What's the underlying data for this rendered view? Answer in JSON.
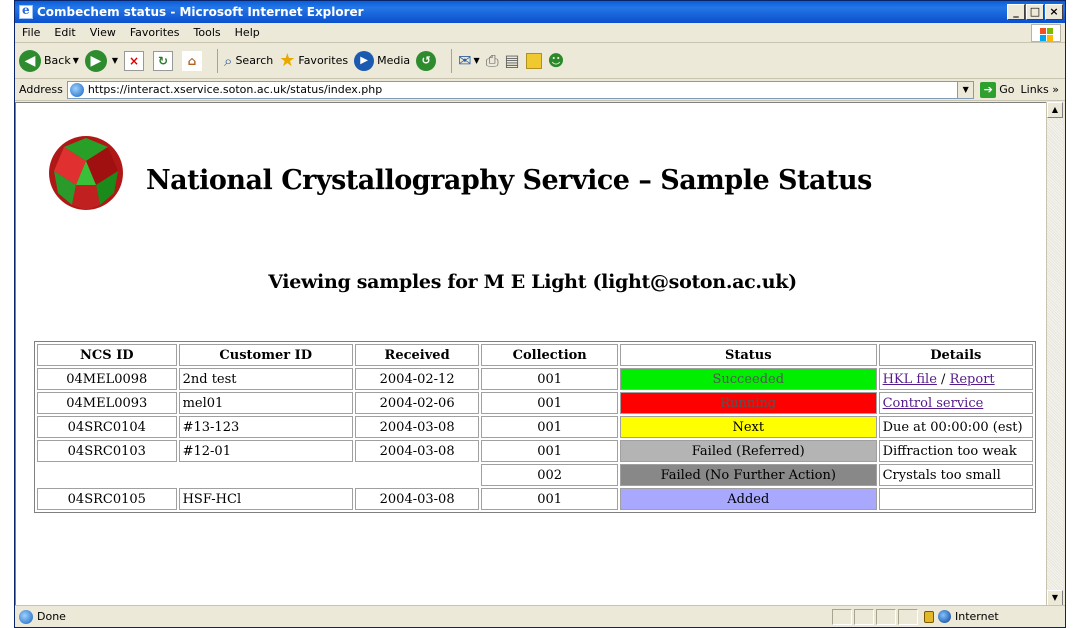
{
  "window": {
    "title": "Combechem status - Microsoft Internet Explorer"
  },
  "menu": [
    "File",
    "Edit",
    "View",
    "Favorites",
    "Tools",
    "Help"
  ],
  "toolbar": {
    "back": "Back",
    "search": "Search",
    "favorites": "Favorites",
    "media": "Media"
  },
  "address": {
    "label": "Address",
    "url": "https://interact.xservice.soton.ac.uk/status/index.php",
    "go": "Go",
    "links": "Links »"
  },
  "page": {
    "title": "National Crystallography Service – Sample Status",
    "subtitle": "Viewing samples for M E Light (light@soton.ac.uk)"
  },
  "table": {
    "headers": [
      "NCS ID",
      "Customer ID",
      "Received",
      "Collection",
      "Status",
      "Details"
    ],
    "rows": [
      {
        "ncs_id": "04MEL0098",
        "customer_id": "2nd test",
        "received": "2004-02-12",
        "collection": "001",
        "status": "Succeeded",
        "details_link1": "HKL file",
        "details_sep": " / ",
        "details_link2": "Report"
      },
      {
        "ncs_id": "04MEL0093",
        "customer_id": "mel01",
        "received": "2004-02-06",
        "collection": "001",
        "status": "Running",
        "details_link1": "Control service"
      },
      {
        "ncs_id": "04SRC0104",
        "customer_id": "#13-123",
        "received": "2004-03-08",
        "collection": "001",
        "status": "Next",
        "details": "Due at 00:00:00 (est)"
      },
      {
        "ncs_id": "04SRC0103",
        "customer_id": "#12-01",
        "received": "2004-03-08",
        "collection": "001",
        "status": "Failed (Referred)",
        "details": "Diffraction too weak"
      },
      {
        "collection": "002",
        "status": "Failed (No Further Action)",
        "details": "Crystals too small"
      },
      {
        "ncs_id": "04SRC0105",
        "customer_id": "HSF-HCl",
        "received": "2004-03-08",
        "collection": "001",
        "status": "Added",
        "details": ""
      }
    ]
  },
  "statusbar": {
    "text": "Done",
    "zone": "Internet"
  },
  "colors": {
    "succeeded": "#00ee00",
    "running": "#ff0000",
    "next": "#ffff00",
    "failed_referred": "#b4b4b4",
    "failed_nfa": "#888888",
    "added": "#a8a8ff"
  }
}
